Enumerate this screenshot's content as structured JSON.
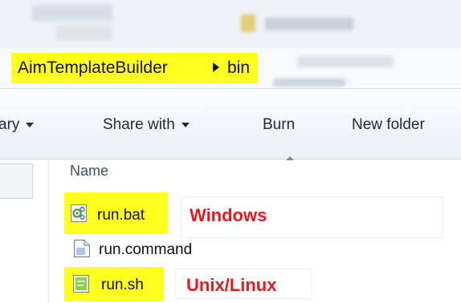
{
  "breadcrumb": {
    "folder": "AimTemplateBuilder",
    "subfolder": "bin"
  },
  "toolbar": {
    "library_label": "ary",
    "share_label": "Share with",
    "burn_label": "Burn",
    "new_folder_label": "New folder"
  },
  "file_list": {
    "column_name": "Name",
    "files": [
      {
        "name": "run.bat",
        "icon": "batch-file-icon",
        "annotation": "Windows"
      },
      {
        "name": "run.command",
        "icon": "generic-file-icon",
        "annotation": ""
      },
      {
        "name": "run.sh",
        "icon": "script-file-icon",
        "annotation": "Unix/Linux"
      }
    ]
  },
  "colors": {
    "highlight": "#ffff1f",
    "annotation_red": "#e8181c"
  }
}
